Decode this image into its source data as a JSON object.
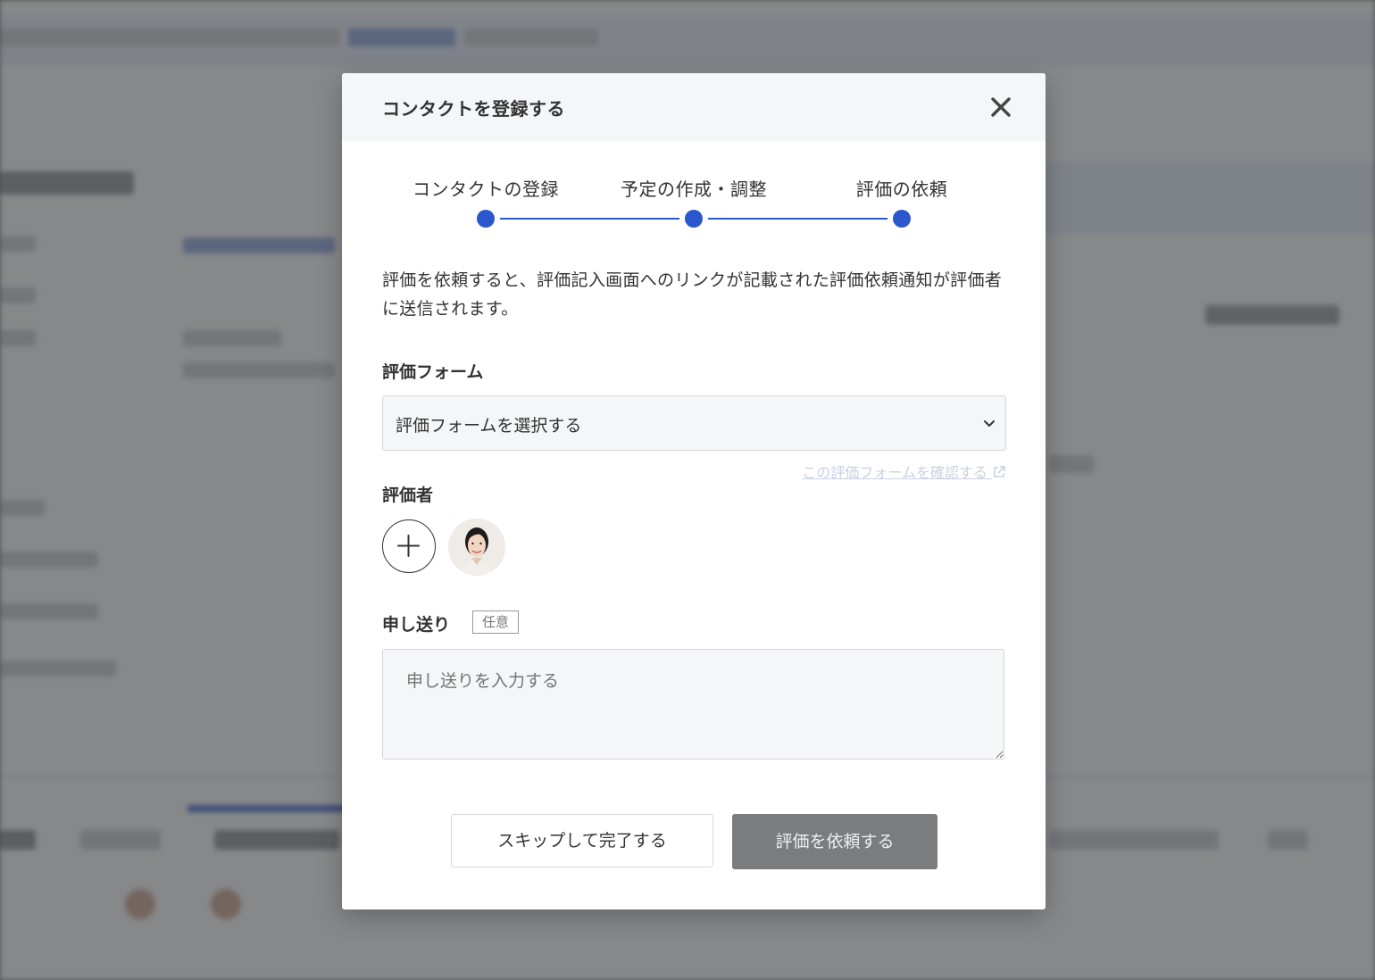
{
  "modal": {
    "title": "コンタクトを登録する",
    "steps": [
      {
        "label": "コンタクトの登録"
      },
      {
        "label": "予定の作成・調整"
      },
      {
        "label": "評価の依頼"
      }
    ],
    "description": "評価を依頼すると、評価記入画面へのリンクが記載された評価依頼通知が評価者に送信されます。",
    "evaluation_form": {
      "label": "評価フォーム",
      "selected_value": "評価フォームを選択する",
      "confirm_link": "この評価フォームを確認する"
    },
    "evaluators": {
      "label": "評価者"
    },
    "handover": {
      "label": "申し送り",
      "optional_badge": "任意",
      "placeholder": "申し送りを入力する"
    },
    "buttons": {
      "skip": "スキップして完了する",
      "request": "評価を依頼する"
    }
  },
  "colors": {
    "accent": "#2a57cc",
    "primary_button": "#7b7c7e"
  }
}
